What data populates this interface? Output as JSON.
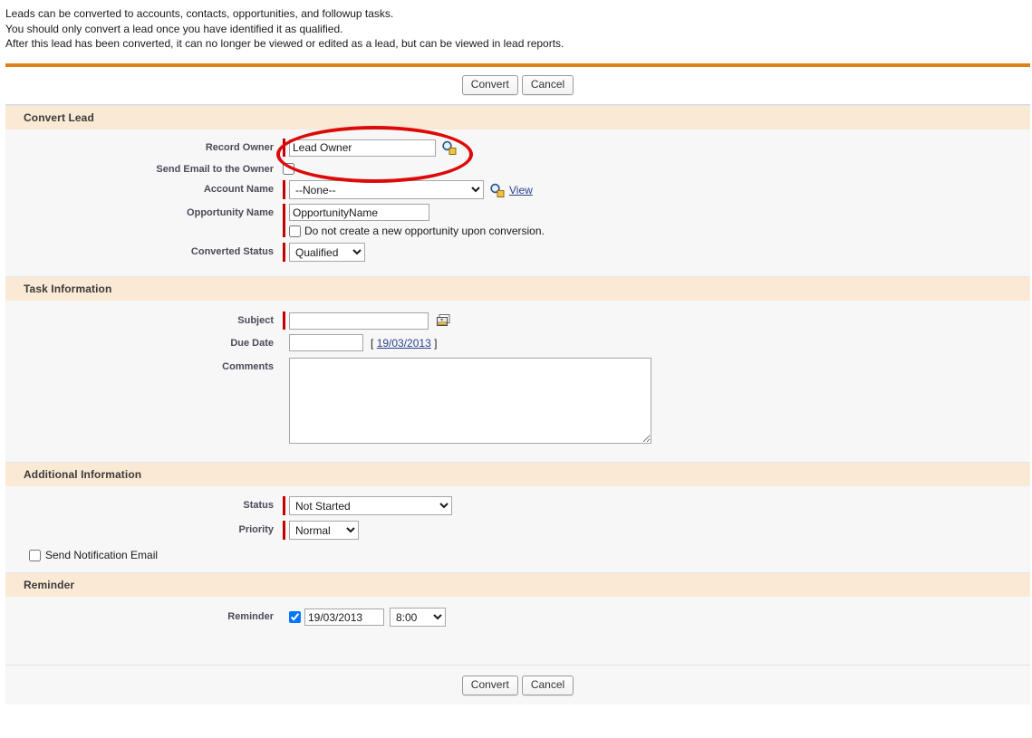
{
  "intro": {
    "line1": "Leads can be converted to accounts, contacts, opportunities, and followup tasks.",
    "line2": "You should only convert a lead once you have identified it as qualified.",
    "line3": "After this lead has been converted, it can no longer be viewed or edited as a lead, but can be viewed in lead reports."
  },
  "toolbar": {
    "convert_label": "Convert",
    "cancel_label": "Cancel"
  },
  "sections": {
    "convert_lead": {
      "title": "Convert Lead",
      "record_owner": {
        "label": "Record Owner",
        "value": "Lead Owner",
        "lookup_icon": "magnifier-lookup-icon"
      },
      "send_email": {
        "label": "Send Email to the Owner",
        "checked": false
      },
      "account_name": {
        "label": "Account Name",
        "value": "--None--",
        "options": [
          "--None--"
        ],
        "lookup_icon": "magnifier-lookup-icon",
        "view_label": "View"
      },
      "opportunity_name": {
        "label": "Opportunity Name",
        "value": "OpportunityName",
        "no_opportunity_label": "Do not create a new opportunity upon conversion.",
        "no_opportunity_checked": false
      },
      "converted_status": {
        "label": "Converted Status",
        "value": "Qualified",
        "options": [
          "Qualified"
        ]
      }
    },
    "task_information": {
      "title": "Task Information",
      "subject": {
        "label": "Subject",
        "value": "",
        "picker_icon": "combo-picklist-icon"
      },
      "due_date": {
        "label": "Due Date",
        "value": "",
        "today_open": "[",
        "today_link": "19/03/2013",
        "today_close": "]"
      },
      "comments": {
        "label": "Comments",
        "value": ""
      }
    },
    "additional_information": {
      "title": "Additional Information",
      "status": {
        "label": "Status",
        "value": "Not Started",
        "options": [
          "Not Started"
        ]
      },
      "priority": {
        "label": "Priority",
        "value": "Normal",
        "options": [
          "Normal"
        ]
      },
      "send_notification_email": {
        "label": "Send Notification Email",
        "checked": false
      }
    },
    "reminder": {
      "title": "Reminder",
      "reminder": {
        "label": "Reminder",
        "checked": true,
        "date": "19/03/2013",
        "time": "8:00",
        "time_options": [
          "8:00"
        ]
      }
    }
  },
  "annotation": {
    "shape": "red-ellipse-highlight",
    "color": "#dd0a0a",
    "targets": "record-owner-field"
  },
  "colors": {
    "accent_orange": "#dd8219",
    "section_header": "#faead5",
    "required_bar": "#c30000",
    "panel_bg": "#f7f7f7",
    "link": "#2a3f8f"
  }
}
